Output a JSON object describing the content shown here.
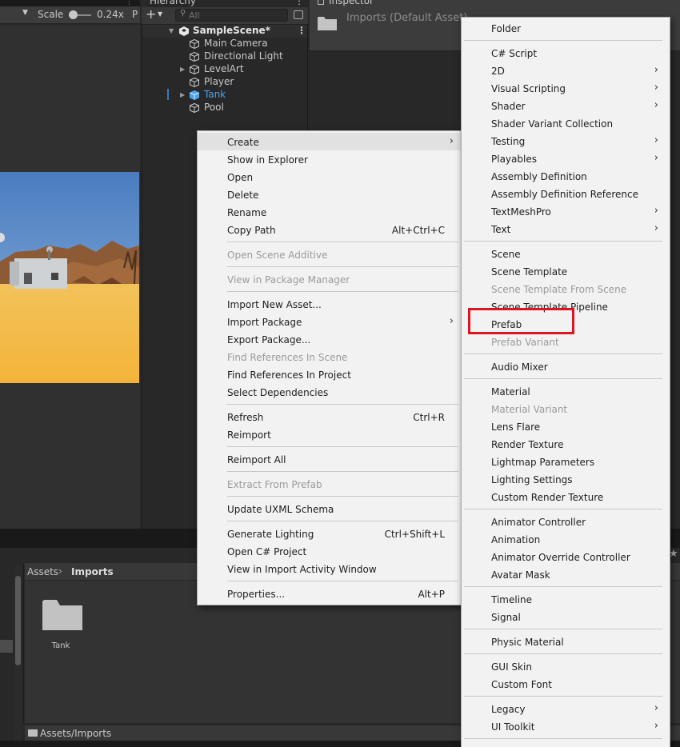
{
  "scene": {
    "scale_label": "Scale",
    "scale_value": "0.24x",
    "extra_label": "P"
  },
  "hierarchy": {
    "tab_title": "Hierarchy",
    "search_placeholder": "All",
    "scene_name": "SampleScene*",
    "items": [
      {
        "label": "Main Camera",
        "expandable": false,
        "selected": false
      },
      {
        "label": "Directional Light",
        "expandable": false,
        "selected": false
      },
      {
        "label": "LevelArt",
        "expandable": true,
        "selected": false
      },
      {
        "label": "Player",
        "expandable": false,
        "selected": false
      },
      {
        "label": "Tank",
        "expandable": true,
        "selected": true,
        "color": "#4ca3f0"
      },
      {
        "label": "Pool",
        "expandable": false,
        "selected": false
      }
    ]
  },
  "inspector": {
    "tab_title": "Inspector",
    "header_title": "Imports (Default Asset)"
  },
  "project": {
    "breadcrumb": [
      "Assets",
      "Imports"
    ],
    "assets": [
      {
        "name": "Tank",
        "icon": "folder-icon"
      }
    ],
    "status_path": "Assets/Imports"
  },
  "context_menu": {
    "items": [
      {
        "label": "Create",
        "submenu": true,
        "hover": true
      },
      {
        "label": "Show in Explorer"
      },
      {
        "label": "Open"
      },
      {
        "label": "Delete"
      },
      {
        "label": "Rename"
      },
      {
        "label": "Copy Path",
        "shortcut": "Alt+Ctrl+C"
      },
      {
        "separator": true
      },
      {
        "label": "Open Scene Additive",
        "disabled": true
      },
      {
        "separator": true
      },
      {
        "label": "View in Package Manager",
        "disabled": true
      },
      {
        "separator": true
      },
      {
        "label": "Import New Asset..."
      },
      {
        "label": "Import Package",
        "submenu": true
      },
      {
        "label": "Export Package..."
      },
      {
        "label": "Find References In Scene",
        "disabled": true
      },
      {
        "label": "Find References In Project"
      },
      {
        "label": "Select Dependencies"
      },
      {
        "separator": true
      },
      {
        "label": "Refresh",
        "shortcut": "Ctrl+R"
      },
      {
        "label": "Reimport"
      },
      {
        "separator": true
      },
      {
        "label": "Reimport All"
      },
      {
        "separator": true
      },
      {
        "label": "Extract From Prefab",
        "disabled": true
      },
      {
        "separator": true
      },
      {
        "label": "Update UXML Schema"
      },
      {
        "separator": true
      },
      {
        "label": "Generate Lighting",
        "shortcut": "Ctrl+Shift+L"
      },
      {
        "label": "Open C# Project"
      },
      {
        "label": "View in Import Activity Window"
      },
      {
        "separator": true
      },
      {
        "label": "Properties...",
        "shortcut": "Alt+P"
      }
    ]
  },
  "create_submenu": {
    "items": [
      {
        "label": "Folder"
      },
      {
        "separator": true
      },
      {
        "label": "C# Script"
      },
      {
        "label": "2D",
        "submenu": true
      },
      {
        "label": "Visual Scripting",
        "submenu": true
      },
      {
        "label": "Shader",
        "submenu": true
      },
      {
        "label": "Shader Variant Collection"
      },
      {
        "label": "Testing",
        "submenu": true
      },
      {
        "label": "Playables",
        "submenu": true
      },
      {
        "label": "Assembly Definition"
      },
      {
        "label": "Assembly Definition Reference"
      },
      {
        "label": "TextMeshPro",
        "submenu": true
      },
      {
        "label": "Text",
        "submenu": true
      },
      {
        "separator": true
      },
      {
        "label": "Scene"
      },
      {
        "label": "Scene Template"
      },
      {
        "label": "Scene Template From Scene",
        "disabled": true
      },
      {
        "label": "Scene Template Pipeline"
      },
      {
        "label": "Prefab",
        "highlighted": true
      },
      {
        "label": "Prefab Variant",
        "disabled": true
      },
      {
        "separator": true
      },
      {
        "label": "Audio Mixer"
      },
      {
        "separator": true
      },
      {
        "label": "Material"
      },
      {
        "label": "Material Variant",
        "disabled": true
      },
      {
        "label": "Lens Flare"
      },
      {
        "label": "Render Texture"
      },
      {
        "label": "Lightmap Parameters"
      },
      {
        "label": "Lighting Settings"
      },
      {
        "label": "Custom Render Texture"
      },
      {
        "separator": true
      },
      {
        "label": "Animator Controller"
      },
      {
        "label": "Animation"
      },
      {
        "label": "Animator Override Controller"
      },
      {
        "label": "Avatar Mask"
      },
      {
        "separator": true
      },
      {
        "label": "Timeline"
      },
      {
        "label": "Signal"
      },
      {
        "separator": true
      },
      {
        "label": "Physic Material"
      },
      {
        "separator": true
      },
      {
        "label": "GUI Skin"
      },
      {
        "label": "Custom Font"
      },
      {
        "separator": true
      },
      {
        "label": "Legacy",
        "submenu": true
      },
      {
        "label": "UI Toolkit",
        "submenu": true
      },
      {
        "separator": true
      }
    ]
  },
  "colors": {
    "highlight_box": "#e0141e",
    "menu_bg": "#f2f2f2",
    "editor_bg": "#282828",
    "selection_blue": "#4ca3f0"
  }
}
